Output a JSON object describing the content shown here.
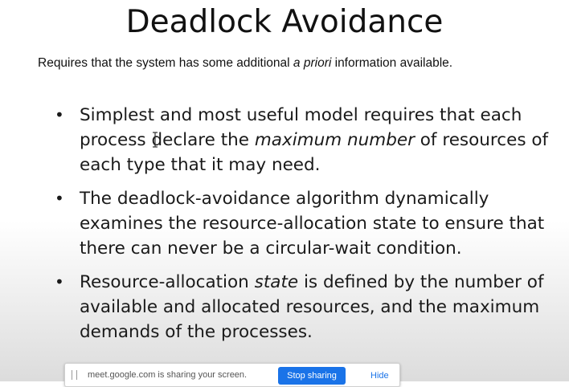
{
  "slide": {
    "title": "Deadlock Avoidance",
    "subtitle_before": "Requires that the system has some additional ",
    "subtitle_italic": "a priori",
    "subtitle_after": " information available.",
    "bullets": [
      {
        "before": "Simplest and most useful model requires that each process declare the ",
        "italic": "maximum number",
        "after": " of resources of each type that it may need."
      },
      {
        "before": "The deadlock-avoidance algorithm dynamically examines the resource-allocation state to ensure that there can never be a circular-wait condition.",
        "italic": "",
        "after": ""
      },
      {
        "before": "Resource-allocation ",
        "italic": "state",
        "after": " is defined by the number of available and allocated resources, and the maximum demands of the processes."
      }
    ],
    "bullet_glyph": "•"
  },
  "screen_share": {
    "message": "meet.google.com is sharing your screen.",
    "stop_label": "Stop sharing",
    "hide_label": "Hide",
    "accent_color": "#1a73e8"
  }
}
